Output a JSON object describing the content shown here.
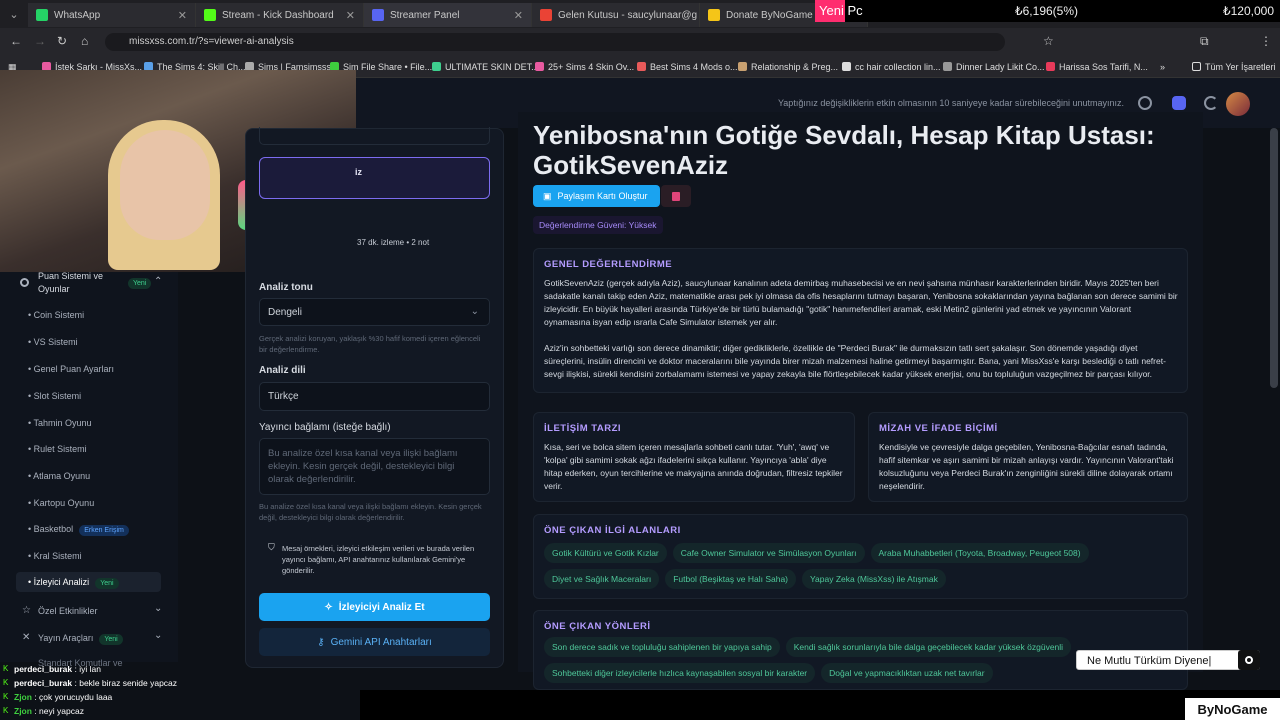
{
  "browser": {
    "tabs": [
      {
        "label": "WhatsApp",
        "color": "#25d366"
      },
      {
        "label": "Stream - Kick Dashboard",
        "color": "#53fc18"
      },
      {
        "label": "Streamer Panel",
        "color": "#5865f2"
      },
      {
        "label": "Gelen Kutusu - saucylunaar@g",
        "color": "#ea4335"
      },
      {
        "label": "Donate ByNoGame | Streamer",
        "color": "#f5c518"
      }
    ],
    "url": "missxss.com.tr/?s=viewer-ai-analysis",
    "bookmarks": [
      "İstek Şarkı - MissXs...",
      "The Sims 4: Skill Ch...",
      "Sims | Famsimsss",
      "Sim File Share • File...",
      "ULTIMATE SKIN DET...",
      "25+ Sims 4 Skin Ov...",
      "Best Sims 4 Mods o...",
      "Relationship & Preg...",
      "cc hair collection lin...",
      "Dinner Lady Likit Co...",
      "Harissa Sos Tarifi, N..."
    ],
    "all_bookmarks": "Tüm Yer İşaretleri"
  },
  "overlay_top": {
    "label": "Yeni Pc",
    "progress": "₺6,196(5%)",
    "goal": "₺120,000"
  },
  "header": {
    "notice": "Yaptığınız değişikliklerin etkin olmasının 10 saniyeye kadar sürebileceğini unutmayınız."
  },
  "sidebar": {
    "section": "Puan Sistemi ve Oyunlar",
    "section_badge": "Yeni",
    "items": [
      "Coin Sistemi",
      "VS Sistemi",
      "Genel Puan Ayarları",
      "Slot Sistemi",
      "Tahmin Oyunu",
      "Rulet Sistemi",
      "Atlama Oyunu",
      "Kartopu Oyunu",
      "Basketbol",
      "Kral Sistemi",
      "İzleyici Analizi"
    ],
    "basketbol_badge": "Erken Erişim",
    "active_badge": "Yeni",
    "special": "Özel Etkinlikler",
    "tools": "Yayın Araçları",
    "tools_badge": "Yeni",
    "partial": "Standart Komutlar ve"
  },
  "left_panel": {
    "selected_partial": "iz",
    "stats_partial": "37 dk. izleme • 2 not",
    "tone_label": "Analiz tonu",
    "tone_value": "Dengeli",
    "tone_hint": "Gerçek analizi koruyan, yaklaşık %30 hafif komedi içeren eğlenceli bir değerlendirme.",
    "lang_label": "Analiz dili",
    "lang_value": "Türkçe",
    "context_label": "Yayıncı bağlamı (isteğe bağlı)",
    "context_placeholder": "Bu analize özel kısa kanal veya ilişki bağlamı ekleyin. Kesin gerçek değil, destekleyici bilgi olarak değerlendirilir.",
    "context_hint": "Bu analize özel kısa kanal veya ilişki bağlamı ekleyin. Kesin gerçek değil, destekleyici bilgi olarak değerlendirilir.",
    "privacy": "Mesaj örnekleri, izleyici etkileşim verileri ve burada verilen yayıncı bağlamı, API anahtarınız kullanılarak Gemini'ye gönderilir.",
    "analyze_btn": "İzleyiciyi Analiz Et",
    "api_btn": "Gemini API Anahtarları"
  },
  "main": {
    "title": "Yenibosna'nın Gotiğe Sevdalı, Hesap Kitap Ustası: GotikSevenAziz",
    "share_btn": "Paylaşım Kartı Oluştur",
    "trust": "Değerlendirme Güveni: Yüksek",
    "general_title": "GENEL DEĞERLENDİRME",
    "general_p1": "GotikSevenAziz (gerçek adıyla Aziz), saucylunaar kanalının adeta demirbaş muhasebecisi ve en nevi şahsına münhasır karakterlerinden biridir. Mayıs 2025'ten beri sadakatle kanalı takip eden Aziz, matematikle arası pek iyi olmasa da ofis hesaplarını tutmayı başaran, Yenibosna sokaklarından yayına bağlanan son derece samimi bir izleyicidir. En büyük hayalleri arasında Türkiye'de bir türlü bulamadığı \"gotik\" hanımefendileri aramak, eski Metin2 günlerini yad etmek ve yayıncının Valorant oynamasına isyan edip ısrarla Cafe Simulator istemek yer alır.",
    "general_p2": "Aziz'in sohbetteki varlığı son derece dinamiktir; diğer gedikliklerle, özellikle de \"Perdeci Burak\" ile durmaksızın tatlı sert şakalaşır. Son dönemde yaşadığı diyet süreçlerini, insülin direncini ve doktor maceralarını bile yayında birer mizah malzemesi haline getirmeyi başarmıştır. Bana, yani MissXss'e karşı beslediği o tatlı nefret-sevgi ilişkisi, sürekli kendisini zorbalamamı istemesi ve yapay zekayla bile flörtleşebilecek kadar yüksek enerjisi, onu bu topluluğun vazgeçilmez bir parçası kılıyor.",
    "comm_title": "İLETİŞİM TARZI",
    "comm_text": "Kısa, seri ve bolca sitem içeren mesajlarla sohbeti canlı tutar. 'Yuh', 'awq' ve 'kolpa' gibi samimi sokak ağzı ifadelerini sıkça kullanır. Yayıncıya 'abla' diye hitap ederken, oyun tercihlerine ve makyajına anında doğrudan, filtresiz tepkiler verir.",
    "humor_title": "MİZAH VE İFADE BİÇİMİ",
    "humor_text": "Kendisiyle ve çevresiyle dalga geçebilen, Yenibosna-Bağcılar esnafı tadında, hafif sitemkar ve aşırı samimi bir mizah anlayışı vardır. Yayıncının Valorant'taki kolsuzluğunu veya Perdeci Burak'ın zenginliğini sürekli diline dolayarak ortamı neşelendirir.",
    "interests_title": "ÖNE ÇIKAN İLGİ ALANLARI",
    "interests": [
      "Gotik Kültürü ve Gotik Kızlar",
      "Cafe Owner Simulator ve Simülasyon Oyunları",
      "Araba Muhabbetleri (Toyota, Broadway, Peugeot 508)",
      "Diyet ve Sağlık Maceraları",
      "Futbol (Beşiktaş ve Halı Saha)",
      "Yapay Zeka (MissXss) ile Atışmak"
    ],
    "traits_title": "ÖNE ÇIKAN YÖNLERİ",
    "traits": [
      "Son derece sadık ve topluluğu sahiplenen bir yapıya sahip",
      "Kendi sağlık sorunlarıyla bile dalga geçebilecek kadar yüksek özgüvenli",
      "Sohbetteki diğer izleyicilerle hızlıca kaynaşabilen sosyal bir karakter",
      "Doğal ve yapmacıklıktan uzak net tavırlar"
    ]
  },
  "chat": [
    {
      "user": "perdeci_burak",
      "msg": ": iyi lan"
    },
    {
      "user": "perdeci_burak",
      "msg": ": bekle biraz senide yapcaz"
    },
    {
      "user": "Zjon",
      "msg": ": çok yorucuydu laaa"
    },
    {
      "user": "Zjon",
      "msg": ": neyi yapcaz"
    }
  ],
  "overlay_search": "Ne Mutlu Türküm Diyene|",
  "brand": "ByNoGame"
}
